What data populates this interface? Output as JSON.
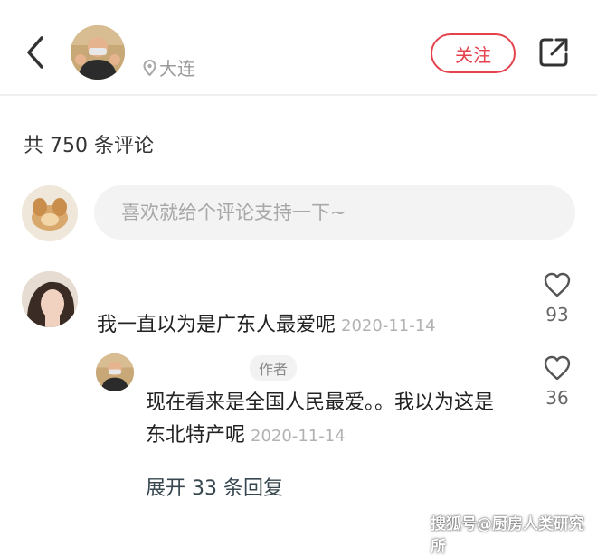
{
  "header": {
    "location": "大连",
    "follow_label": "关注"
  },
  "comments_header": {
    "count_text": "共 750 条评论"
  },
  "input": {
    "placeholder": "喜欢就给个评论支持一下~"
  },
  "comments": [
    {
      "text": "我一直以为是广东人最爱呢",
      "time": "2020-11-14",
      "likes": "93",
      "replies": [
        {
          "tag": "作者",
          "text": "现在看来是全国人民最爱。。我以为这是东北特产呢",
          "time": "2020-11-14",
          "likes": "36"
        }
      ],
      "expand_label": "展开 33 条回复"
    }
  ],
  "watermark": "搜狐号@厨房人类研究所",
  "colors": {
    "accent": "#e5424d",
    "muted": "#b2b2b2"
  }
}
